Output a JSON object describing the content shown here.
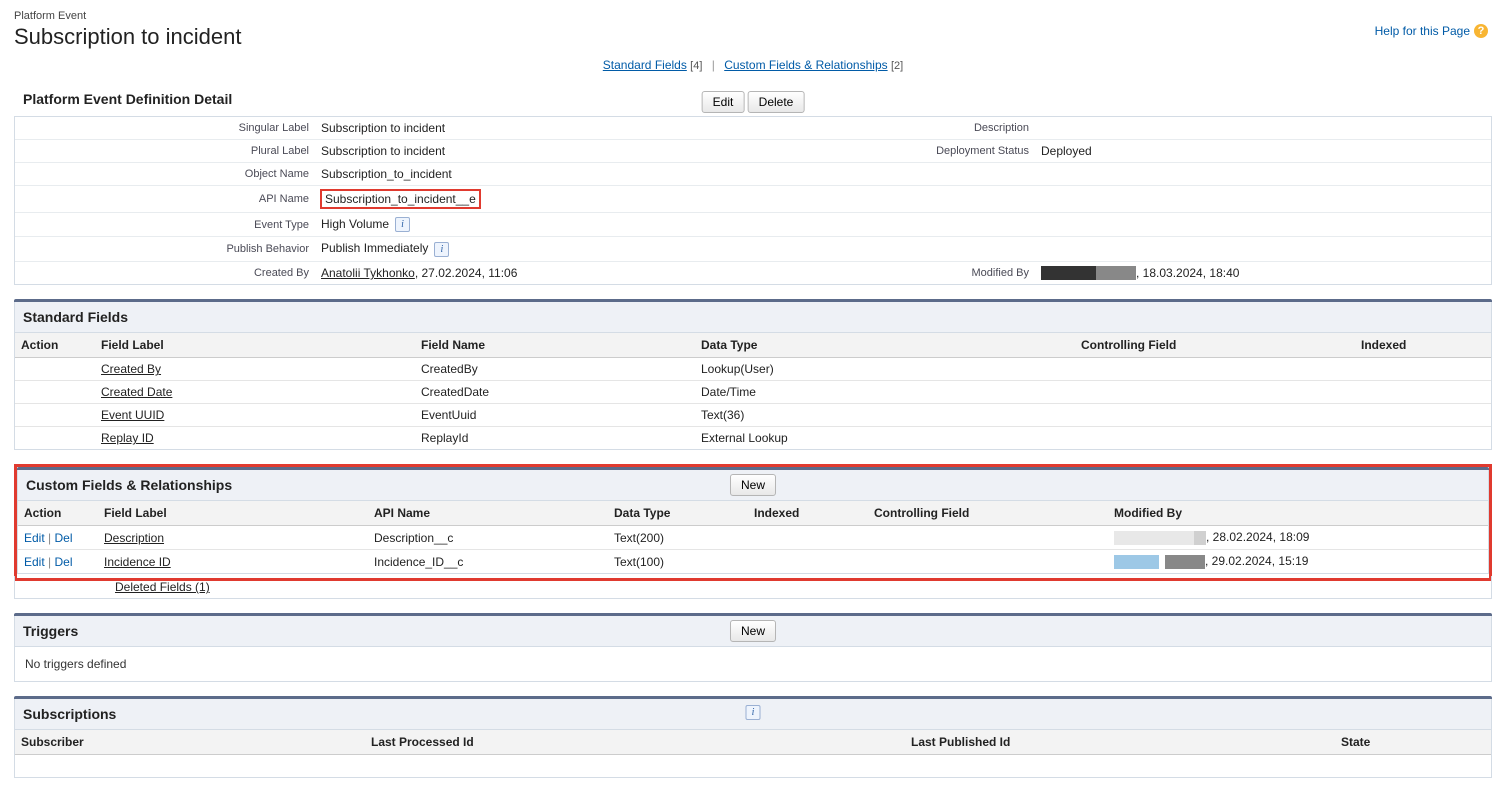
{
  "header": {
    "crumb": "Platform Event",
    "title": "Subscription to incident",
    "help_text": "Help for this Page"
  },
  "anchors": {
    "standard_fields": "Standard Fields",
    "standard_count": "[4]",
    "custom_fields": "Custom Fields & Relationships",
    "custom_count": "[2]"
  },
  "detail": {
    "section_title": "Platform Event Definition Detail",
    "edit_btn": "Edit",
    "delete_btn": "Delete",
    "labels": {
      "singular": "Singular Label",
      "plural": "Plural Label",
      "object_name": "Object Name",
      "api_name": "API Name",
      "event_type": "Event Type",
      "publish_behavior": "Publish Behavior",
      "created_by": "Created By",
      "description": "Description",
      "deployment_status": "Deployment Status",
      "modified_by": "Modified By"
    },
    "values": {
      "singular": "Subscription to incident",
      "plural": "Subscription to incident",
      "object_name": "Subscription_to_incident",
      "api_name": "Subscription_to_incident__e",
      "event_type": "High Volume",
      "publish_behavior": "Publish Immediately",
      "created_by_name": "Anatolii Tykhonko",
      "created_by_date": ", 27.02.2024, 11:06",
      "deployment_status": "Deployed",
      "modified_by_date": ", 18.03.2024, 18:40"
    }
  },
  "standard": {
    "title": "Standard Fields",
    "headers": {
      "action": "Action",
      "field_label": "Field Label",
      "field_name": "Field Name",
      "data_type": "Data Type",
      "controlling": "Controlling Field",
      "indexed": "Indexed"
    },
    "rows": [
      {
        "label": "Created By",
        "name": "CreatedBy",
        "type": "Lookup(User)"
      },
      {
        "label": "Created Date",
        "name": "CreatedDate",
        "type": "Date/Time"
      },
      {
        "label": "Event UUID",
        "name": "EventUuid",
        "type": "Text(36)"
      },
      {
        "label": "Replay ID",
        "name": "ReplayId",
        "type": "External Lookup"
      }
    ]
  },
  "custom": {
    "title": "Custom Fields & Relationships",
    "new_btn": "New",
    "edit_txt": "Edit",
    "del_txt": "Del",
    "headers": {
      "action": "Action",
      "field_label": "Field Label",
      "api_name": "API Name",
      "data_type": "Data Type",
      "indexed": "Indexed",
      "controlling": "Controlling Field",
      "modified_by": "Modified By"
    },
    "rows": [
      {
        "label": "Description",
        "api": "Description__c",
        "type": "Text(200)",
        "date": ", 28.02.2024, 18:09"
      },
      {
        "label": "Incidence ID",
        "api": "Incidence_ID__c",
        "type": "Text(100)",
        "date": ", 29.02.2024, 15:19"
      }
    ],
    "deleted_link": "Deleted Fields (1)"
  },
  "triggers": {
    "title": "Triggers",
    "new_btn": "New",
    "empty": "No triggers defined"
  },
  "subs": {
    "title": "Subscriptions",
    "headers": {
      "subscriber": "Subscriber",
      "last_processed": "Last Processed Id",
      "last_published": "Last Published Id",
      "state": "State"
    }
  }
}
